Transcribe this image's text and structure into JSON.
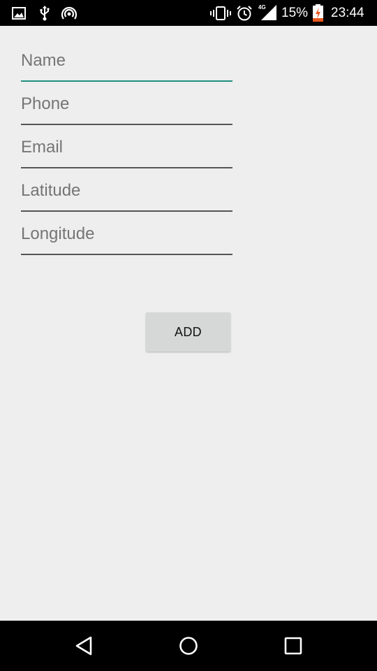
{
  "status_bar": {
    "time": "23:44",
    "battery_percent": "15%",
    "network_type": "4G",
    "icons": [
      "image-icon",
      "usb-icon",
      "hotspot-icon",
      "vibrate-icon",
      "alarm-icon",
      "signal-icon",
      "battery-charging-icon"
    ]
  },
  "form": {
    "name": {
      "placeholder": "Name",
      "value": ""
    },
    "phone": {
      "placeholder": "Phone",
      "value": ""
    },
    "email": {
      "placeholder": "Email",
      "value": ""
    },
    "latitude": {
      "placeholder": "Latitude",
      "value": ""
    },
    "longitude": {
      "placeholder": "Longitude",
      "value": ""
    },
    "add_label": "ADD",
    "accent_color": "#1f8f7f"
  },
  "nav_bar": {
    "icons": [
      "back-icon",
      "home-icon",
      "recents-icon"
    ]
  }
}
